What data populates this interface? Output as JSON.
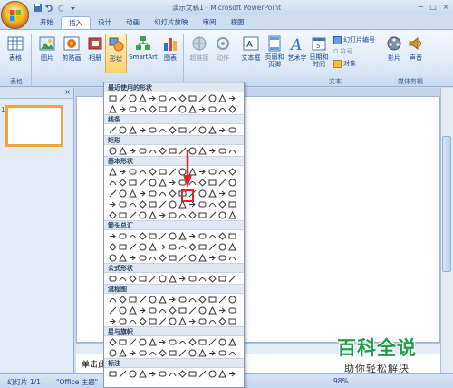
{
  "window": {
    "title": "演示文稿1 - Microsoft PowerPoint"
  },
  "tabs": [
    {
      "label": "开始"
    },
    {
      "label": "插入"
    },
    {
      "label": "设计"
    },
    {
      "label": "动画"
    },
    {
      "label": "幻灯片放映"
    },
    {
      "label": "审阅"
    },
    {
      "label": "视图"
    }
  ],
  "ribbon": {
    "table": "表格",
    "picture": "图片",
    "clipart": "剪贴画",
    "album": "相册",
    "shapes": "形状",
    "smartart": "SmartArt",
    "chart": "图表",
    "hyperlink": "超链接",
    "action": "动作",
    "textbox": "文本框",
    "header_footer": "页眉和\n页脚",
    "wordart": "艺术字",
    "datetime": "日期和\n时间",
    "slide_number": "幻灯片编号",
    "symbol": "符号",
    "object": "对象",
    "movie": "影片",
    "sound": "声音",
    "group_table": "表格",
    "group_text": "文本",
    "group_media": "媒体剪辑"
  },
  "gallery": {
    "sections": [
      "最近使用的形状",
      "线条",
      "矩形",
      "基本形状",
      "箭头总汇",
      "公式形状",
      "流程图",
      "星与旗帜",
      "标注"
    ]
  },
  "left_pane": {
    "slide_number": "1"
  },
  "notes": {
    "placeholder": "单击此"
  },
  "status": {
    "slide": "幻灯片 1/1",
    "theme": "\"Office 主题\"",
    "zoom": "98%"
  },
  "watermark": {
    "line1": "百科全说",
    "line2": "助你轻松解决"
  },
  "colors": {
    "accent": "#15428b",
    "highlight": "#e3242b",
    "brand_green": "#1d9e4a"
  }
}
